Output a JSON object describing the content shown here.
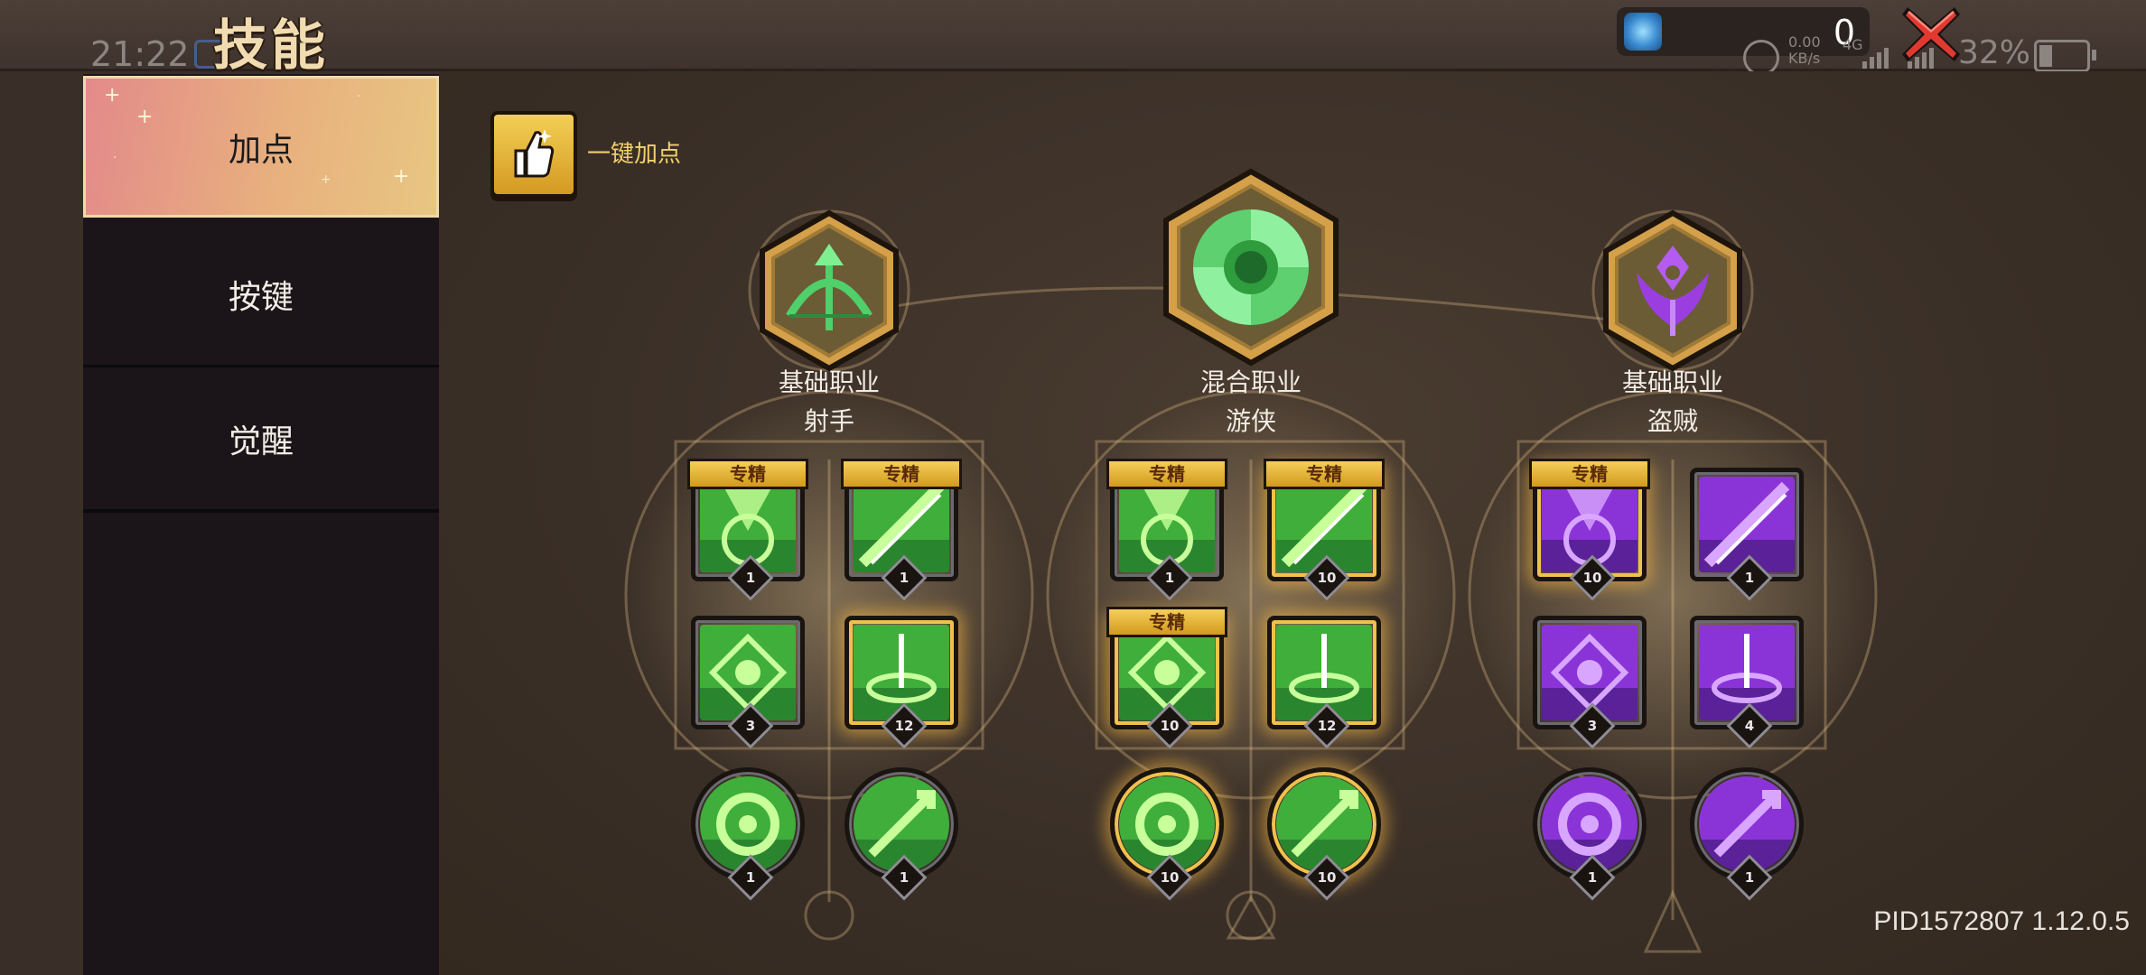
{
  "header": {
    "title": "技能",
    "status_time": "21:22",
    "currency_value": "0",
    "status_speed": "0.00\nKB/s",
    "status_net": "4G",
    "battery_percent": "32%"
  },
  "sidebar": {
    "items": [
      {
        "label": "加点",
        "active": true
      },
      {
        "label": "按键",
        "active": false
      },
      {
        "label": "觉醒",
        "active": false
      }
    ]
  },
  "main": {
    "auto_allocate_label": "一键加点",
    "classes": [
      {
        "type": "基础职业",
        "name": "射手",
        "color": "#3fbf4a",
        "skills": [
          {
            "level": "1",
            "spec": "专精",
            "label_icon": "vortex-slash-icon",
            "gold": false,
            "shape": "square"
          },
          {
            "level": "1",
            "spec": "专精",
            "label_icon": "piercing-arrow-icon",
            "gold": false,
            "shape": "square"
          },
          {
            "level": "3",
            "spec": "",
            "label_icon": "target-crosshair-icon",
            "gold": false,
            "shape": "square"
          },
          {
            "level": "12",
            "spec": "",
            "label_icon": "arrow-rain-icon",
            "gold": true,
            "shape": "square"
          },
          {
            "level": "1",
            "spec": "",
            "label_icon": "cycle-ring-icon",
            "gold": false,
            "shape": "round"
          },
          {
            "level": "1",
            "spec": "",
            "label_icon": "green-arrow-icon",
            "gold": false,
            "shape": "round"
          }
        ]
      },
      {
        "type": "混合职业",
        "name": "游侠",
        "color": "#3fbf4a",
        "skills": [
          {
            "level": "1",
            "spec": "专精",
            "label_icon": "lightning-burst-icon",
            "gold": false,
            "shape": "square"
          },
          {
            "level": "10",
            "spec": "专精",
            "label_icon": "spiral-orb-icon",
            "gold": true,
            "shape": "square"
          },
          {
            "level": "10",
            "spec": "专精",
            "label_icon": "wind-slash-icon",
            "gold": true,
            "shape": "square"
          },
          {
            "level": "12",
            "spec": "",
            "label_icon": "owl-icon",
            "gold": true,
            "shape": "square"
          },
          {
            "level": "10",
            "spec": "",
            "label_icon": "up-arrow-icon",
            "gold": true,
            "shape": "round"
          },
          {
            "level": "10",
            "spec": "",
            "label_icon": "green-beam-icon",
            "gold": true,
            "shape": "round"
          }
        ]
      },
      {
        "type": "基础职业",
        "name": "盗贼",
        "color": "#a040e0",
        "skills": [
          {
            "level": "10",
            "spec": "专精",
            "label_icon": "shadow-dash-icon",
            "gold": true,
            "shape": "square"
          },
          {
            "level": "1",
            "spec": "",
            "label_icon": "twin-daggers-icon",
            "gold": false,
            "shape": "square"
          },
          {
            "level": "3",
            "spec": "",
            "label_icon": "purple-skull-icon",
            "gold": false,
            "shape": "square"
          },
          {
            "level": "4",
            "spec": "",
            "label_icon": "sword-pillar-icon",
            "gold": false,
            "shape": "square"
          },
          {
            "level": "1",
            "spec": "",
            "label_icon": "purple-flames-icon",
            "gold": false,
            "shape": "round"
          },
          {
            "level": "1",
            "spec": "",
            "label_icon": "purple-heal-icon",
            "gold": false,
            "shape": "round"
          }
        ]
      }
    ]
  },
  "footer": {
    "pid": "PID1572807 1.12.0.5"
  }
}
